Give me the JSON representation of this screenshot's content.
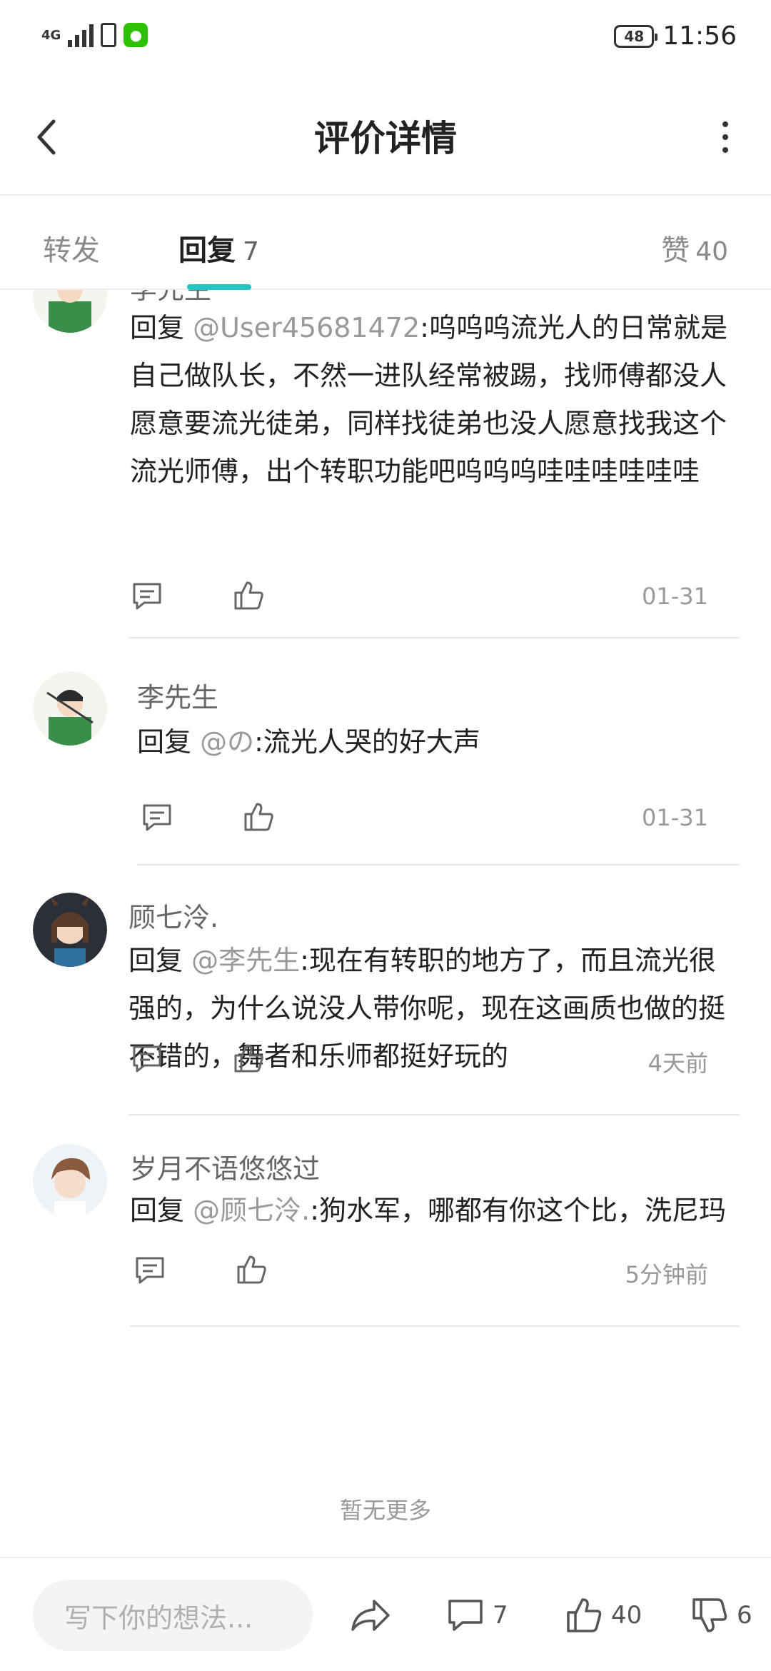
{
  "status_bar": {
    "network": "4G",
    "battery": "48",
    "time": "11:56"
  },
  "header": {
    "title": "评价详情"
  },
  "tabs": {
    "forward": "转发",
    "reply": "回复",
    "reply_count": "7",
    "like": "赞",
    "like_count": "40"
  },
  "comments": [
    {
      "name": "李先生",
      "reply_word": "回复",
      "mention": "@User45681472",
      "text": ":呜呜呜流光人的日常就是自己做队长，不然一进队经常被踢，找师傅都没人愿意要流光徒弟，同样找徒弟也没人愿意找我这个流光师傅，出个转职功能吧呜呜呜哇哇哇哇哇哇",
      "date": "01-31"
    },
    {
      "name": "李先生",
      "reply_word": "回复",
      "mention": "@の",
      "text": ":流光人哭的好大声",
      "date": "01-31"
    },
    {
      "name": "顾七泠.",
      "reply_word": "回复",
      "mention": "@李先生",
      "text": ":现在有转职的地方了，而且流光很强的，为什么说没人带你呢，现在这画质也做的挺不错的，舞者和乐师都挺好玩的",
      "date": "4天前"
    },
    {
      "name": "岁月不语悠悠过",
      "reply_word": "回复",
      "mention": "@顾七泠.",
      "text": ":狗水军，哪都有你这个比，洗尼玛",
      "date": "5分钟前"
    }
  ],
  "no_more": "暂无更多",
  "bottom_bar": {
    "input_placeholder": "写下你的想法...",
    "comment_count": "7",
    "like_count": "40",
    "dislike_count": "6"
  },
  "colors": {
    "accent": "#22c4c4",
    "mention": "#999999"
  }
}
